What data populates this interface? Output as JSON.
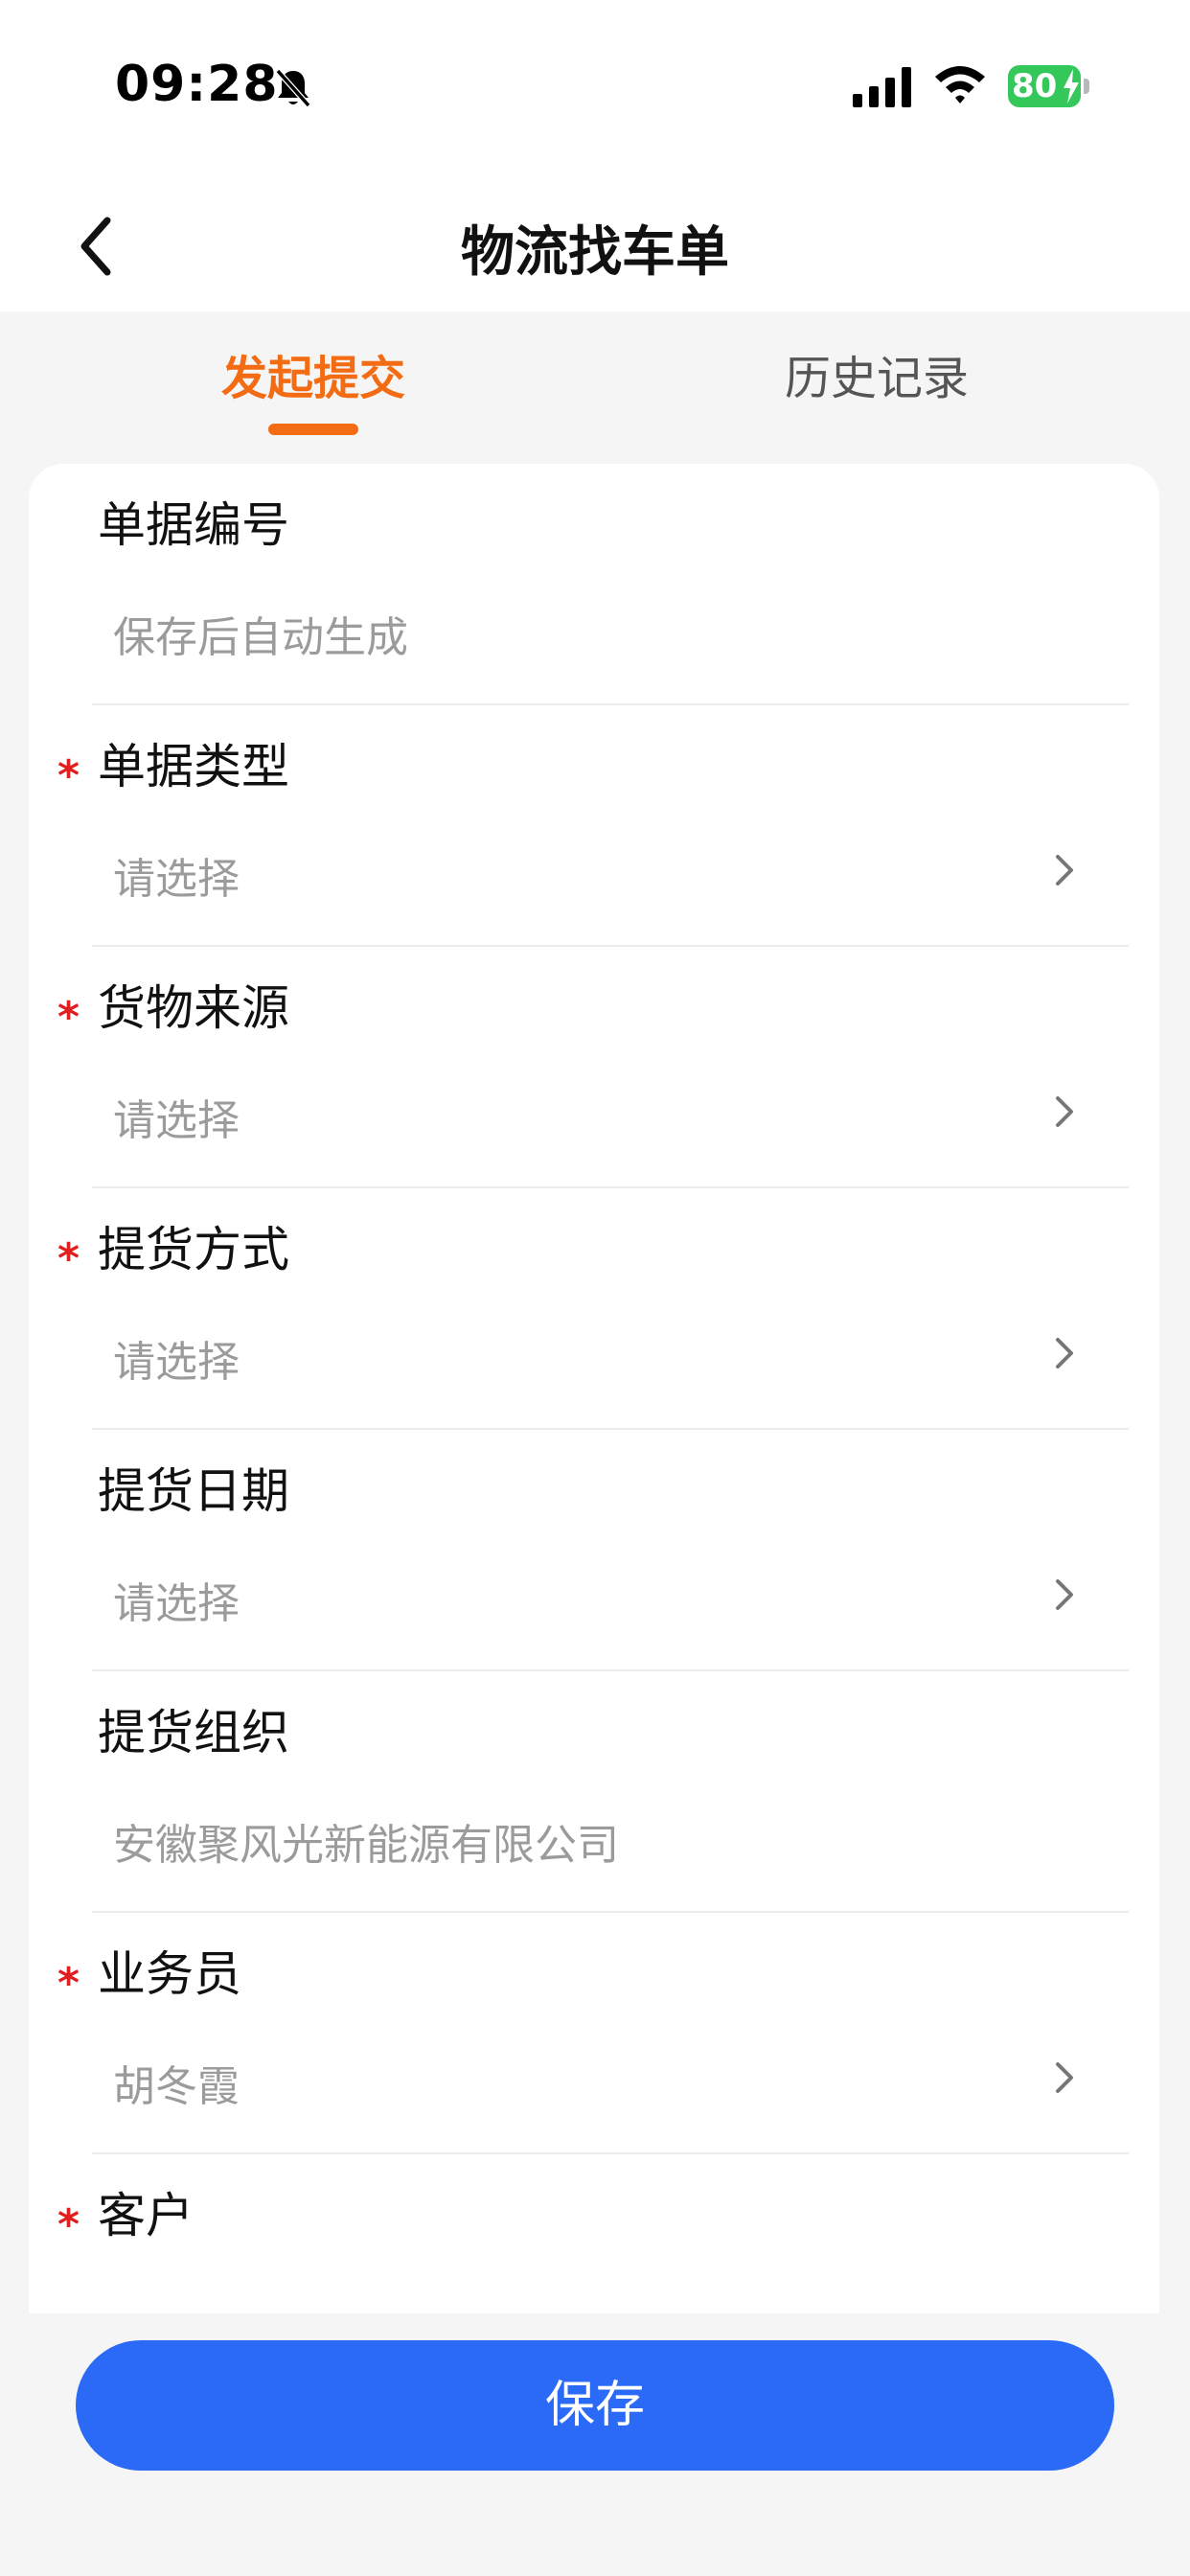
{
  "status_bar": {
    "time": "09:28",
    "battery": "80",
    "icons": [
      "bell-slash-icon",
      "signal-icon",
      "wifi-icon",
      "battery-icon"
    ]
  },
  "nav": {
    "title": "物流找车单",
    "back_icon": "chevron-left-icon"
  },
  "tabs": [
    {
      "label": "发起提交",
      "active": true
    },
    {
      "label": "历史记录",
      "active": false
    }
  ],
  "form": {
    "fields": [
      {
        "label": "单据编号",
        "required": false,
        "value": "保存后自动生成",
        "chevron": false
      },
      {
        "label": "单据类型",
        "required": true,
        "value": "请选择",
        "chevron": true
      },
      {
        "label": "货物来源",
        "required": true,
        "value": "请选择",
        "chevron": true
      },
      {
        "label": "提货方式",
        "required": true,
        "value": "请选择",
        "chevron": true
      },
      {
        "label": "提货日期",
        "required": false,
        "value": "请选择",
        "chevron": true
      },
      {
        "label": "提货组织",
        "required": false,
        "value": "安徽聚风光新能源有限公司",
        "chevron": false
      },
      {
        "label": "业务员",
        "required": true,
        "value": "胡冬霞",
        "chevron": true
      },
      {
        "label": "客户",
        "required": true,
        "value": "",
        "chevron": false
      }
    ],
    "required_mark": "*"
  },
  "actions": {
    "save_label": "保存"
  },
  "colors": {
    "accent": "#f36c14",
    "primary_button": "#2a6af6",
    "required": "#e02020",
    "placeholder": "#9b9b9b",
    "battery": "#34c759"
  }
}
